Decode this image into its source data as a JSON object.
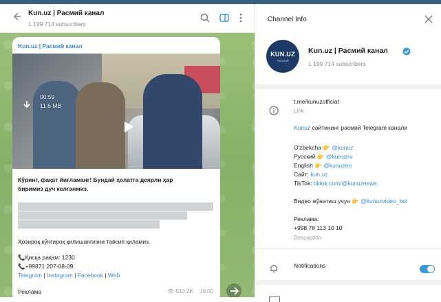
{
  "chat": {
    "title": "Kun.uz | Расмий канал",
    "subscribers": "1 199 714 subscribers"
  },
  "post": {
    "channel": "Kun.uz | Расмий канал",
    "video_duration": "00:59",
    "video_size": "11.6 MB",
    "caption_line1": "Кўринг, фақат йиғламанг! Бундай ҳолатга деярли ҳар",
    "caption_line2": "биримиз дуч келганмиз.",
    "text_line": "Ҳозироқ кўнғироқ қилишангизни тавсия қиламиз.",
    "phone_short": "📞Қисқа рақам: 1230",
    "phone_full": "📞+99871 207-08-09",
    "links": [
      "Telegram",
      "Instagram",
      "Facebook",
      "Web"
    ],
    "link_sep": " | ",
    "ad_label": "Реклама",
    "views": "510.2K",
    "time": "10:00"
  },
  "info": {
    "header": "Channel Info",
    "channel_name": "Kun.uz | Расмий канал",
    "subscribers": "1 199 714 subscribers",
    "link": "t.me/kunuzofficial",
    "link_label": "Link",
    "desc_link": "Kunuz",
    "desc_rest": " сайтининг расмий Telegram канали",
    "lang_uz_label": "O'zbekcha 👉 ",
    "lang_uz": "@kunuz",
    "lang_ru_label": "Русский 👉 ",
    "lang_ru": "@kunuzru",
    "lang_en_label": "English 👉 ",
    "lang_en": "@kunuzen",
    "site_label": "Сайт: ",
    "site": "kun.uz",
    "tiktok_label": "TikTok: ",
    "tiktok": "tiktok.com/@kunuznews",
    "video_label": "Видео жўнатиш учун 👉 ",
    "video_bot": "@kunuzvideo_bot",
    "ad_label": "Реклама:",
    "ad_phone": "+998 78 113 10 10",
    "description_label": "Description",
    "notifications": "Notifications",
    "notifications_on": true
  },
  "logo": {
    "text": "KUN.UZ",
    "sub": "РАСМИЙ"
  },
  "colors": {
    "accent": "#3a8bd0",
    "toggle": "#3a9ad9",
    "logo_bg": "#1e3a66"
  }
}
